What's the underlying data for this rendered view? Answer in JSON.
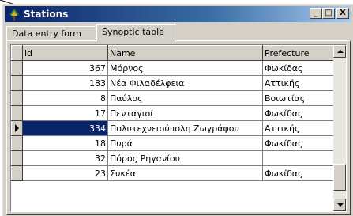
{
  "window": {
    "title": "Stations"
  },
  "titlebar_buttons": {
    "minimize": "_",
    "maximize": "□",
    "close": "X"
  },
  "tabs": [
    {
      "label": "Data entry form",
      "active": false
    },
    {
      "label": "Synoptic table",
      "active": true
    }
  ],
  "table": {
    "columns": [
      "id",
      "Name",
      "Prefecture"
    ],
    "rows": [
      {
        "id": "367",
        "name": "Μόρνος",
        "prefecture": "Φωκίδας",
        "selected": false
      },
      {
        "id": "183",
        "name": "Νέα Φιλαδέλφεια",
        "prefecture": "Αττικής",
        "selected": false
      },
      {
        "id": "8",
        "name": "Παύλος",
        "prefecture": "Βοιωτίας",
        "selected": false
      },
      {
        "id": "17",
        "name": "Πενταγιοί",
        "prefecture": "Φωκίδας",
        "selected": false
      },
      {
        "id": "334",
        "name": "Πολυτεχνειούπολη Ζωγράφου",
        "prefecture": "Αττικής",
        "selected": true
      },
      {
        "id": "18",
        "name": "Πυρά",
        "prefecture": "Φωκίδας",
        "selected": false
      },
      {
        "id": "32",
        "name": "Πόρος Ρηγανίου",
        "prefecture": "",
        "selected": false
      },
      {
        "id": "23",
        "name": "Συκέα",
        "prefecture": "Φωκίδας",
        "selected": false
      }
    ]
  },
  "colors": {
    "selection": "#0a246a",
    "title_gradient_start": "#0a246a",
    "title_gradient_end": "#a6caf0",
    "face": "#d4d0c8"
  }
}
